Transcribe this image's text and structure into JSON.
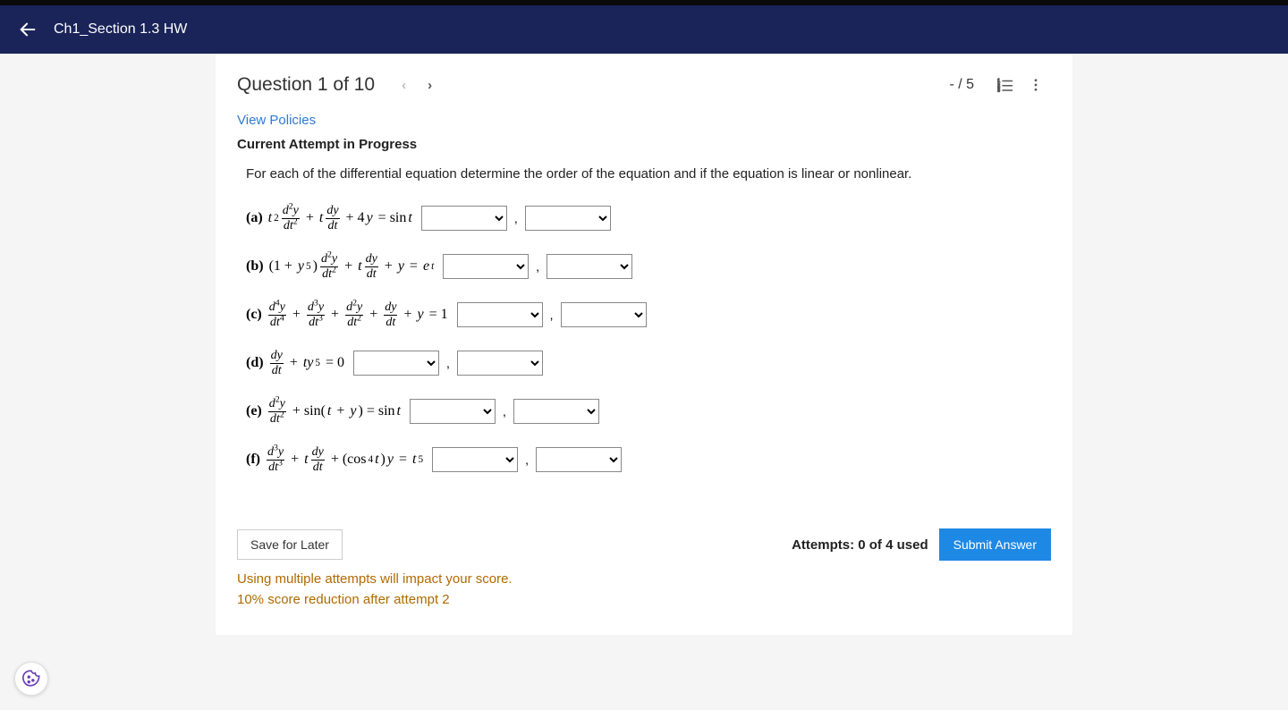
{
  "header": {
    "title": "Ch1_Section 1.3 HW"
  },
  "toolbar": {
    "question_label": "Question 1 of 10",
    "score": "- / 5"
  },
  "links": {
    "view_policies": "View Policies"
  },
  "status": {
    "current_attempt": "Current Attempt in Progress"
  },
  "prompt": "For each of the differential equation determine the order of the equation and if the equation is linear or nonlinear.",
  "rows": {
    "a": {
      "label": "(a)"
    },
    "b": {
      "label": "(b)"
    },
    "c": {
      "label": "(c)"
    },
    "d": {
      "label": "(d)"
    },
    "e": {
      "label": "(e)"
    },
    "f": {
      "label": "(f)"
    }
  },
  "buttons": {
    "save": "Save for Later",
    "submit": "Submit Answer"
  },
  "attempts": "Attempts: 0 of 4 used",
  "warning": {
    "line1": "Using multiple attempts will impact your score.",
    "line2": "10% score reduction after attempt 2"
  }
}
